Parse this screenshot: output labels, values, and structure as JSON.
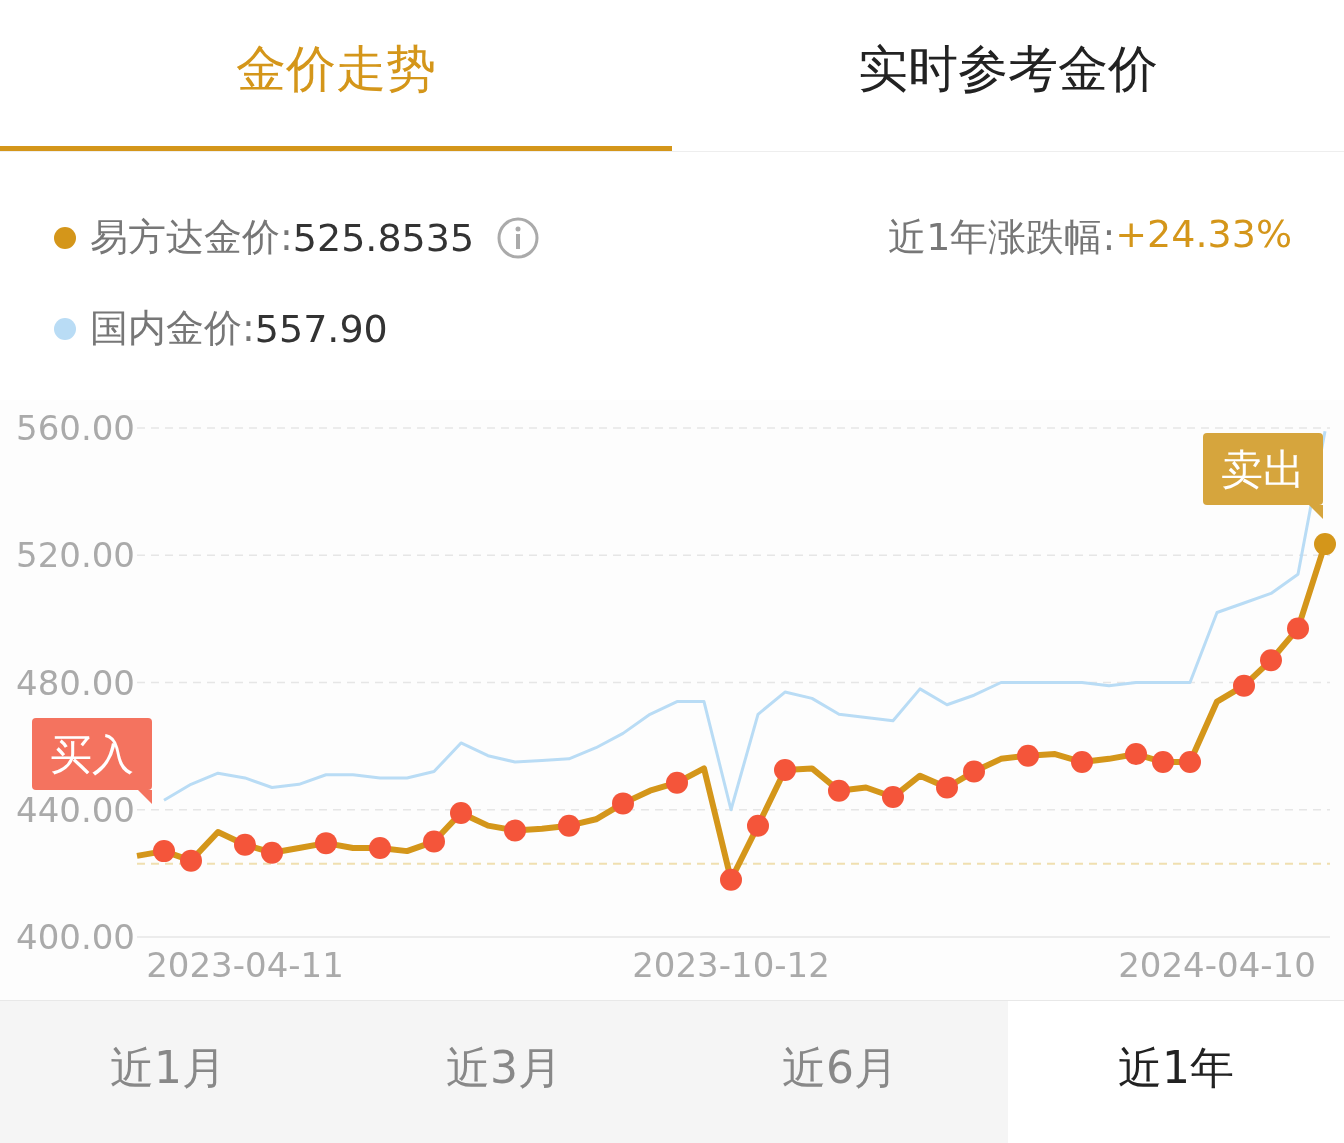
{
  "tabs": [
    {
      "label": "金价走势",
      "selected": true
    },
    {
      "label": "实时参考金价",
      "selected": false
    }
  ],
  "legend": [
    {
      "label": "易方达金价:",
      "value": "525.8535",
      "color": "#d4961a",
      "info": true
    },
    {
      "label": "国内金价:",
      "value": "557.90",
      "color": "#b9dcf5",
      "info": false
    }
  ],
  "change": {
    "label": "近1年涨跌幅:",
    "value": "+24.33%"
  },
  "chart": {
    "callouts": [
      {
        "kind": "buy",
        "label": "买入",
        "color": "#f4735f"
      },
      {
        "kind": "sell",
        "label": "卖出",
        "color": "#d6a53d"
      }
    ],
    "chart_data": {
      "type": "line",
      "categories": [
        null,
        null,
        null,
        null,
        "2023-04-11",
        null,
        null,
        null,
        null,
        null,
        null,
        null,
        null,
        null,
        null,
        null,
        null,
        null,
        null,
        null,
        null,
        null,
        "2023-10-12",
        null,
        null,
        null,
        null,
        null,
        null,
        null,
        null,
        null,
        null,
        null,
        null,
        null,
        null,
        null,
        null,
        null,
        "2024-04-10",
        null,
        null,
        null,
        null
      ],
      "grid": true,
      "ylim": [
        400,
        560
      ],
      "yticks": [
        {
          "value": 400,
          "label": "400.00"
        },
        {
          "value": 440,
          "label": "440.00"
        },
        {
          "value": 480,
          "label": "480.00"
        },
        {
          "value": 520,
          "label": "520.00"
        },
        {
          "value": 560,
          "label": "560.00"
        }
      ],
      "ref_lines": [
        {
          "axis": "y",
          "value": 423
        }
      ],
      "series": [
        {
          "color": "#b9dcf5",
          "values": [
            null,
            443,
            448,
            451.5,
            450,
            447,
            448,
            451,
            451,
            450,
            450,
            452,
            461,
            457,
            455,
            455.5,
            456,
            459.5,
            464,
            470,
            474,
            474,
            440,
            470,
            477,
            475,
            470,
            469,
            468,
            478,
            473,
            476,
            480,
            480,
            480,
            480,
            479,
            480,
            480,
            480,
            502,
            505,
            508,
            514,
            559
          ]
        },
        {
          "color": "#d4961a",
          "values": [
            425.5,
            427,
            424,
            433,
            429,
            426.5,
            428,
            429.5,
            428,
            428,
            427,
            430,
            439,
            435,
            433.5,
            434,
            435,
            437,
            442,
            446,
            448.5,
            453,
            418,
            435,
            452.5,
            453,
            446,
            447,
            444,
            450.7,
            447,
            452,
            456,
            457,
            457.5,
            455,
            456,
            457.5,
            455,
            455,
            474,
            479,
            487,
            497,
            523.5
          ]
        },
        {
          "color": "#f4553a",
          "type": "scatter",
          "values": [
            null,
            427,
            424,
            null,
            429,
            426.5,
            null,
            429.5,
            null,
            428,
            null,
            430,
            439,
            null,
            433.5,
            null,
            435,
            null,
            442,
            null,
            448.5,
            null,
            418,
            435,
            452.5,
            null,
            446,
            null,
            444,
            null,
            447,
            452,
            null,
            457,
            null,
            455,
            null,
            457.5,
            455,
            455,
            null,
            479,
            487,
            497,
            null
          ]
        }
      ]
    }
  },
  "ranges": [
    {
      "label": "近1月",
      "selected": false
    },
    {
      "label": "近3月",
      "selected": false
    },
    {
      "label": "近6月",
      "selected": false
    },
    {
      "label": "近1年",
      "selected": true
    }
  ]
}
